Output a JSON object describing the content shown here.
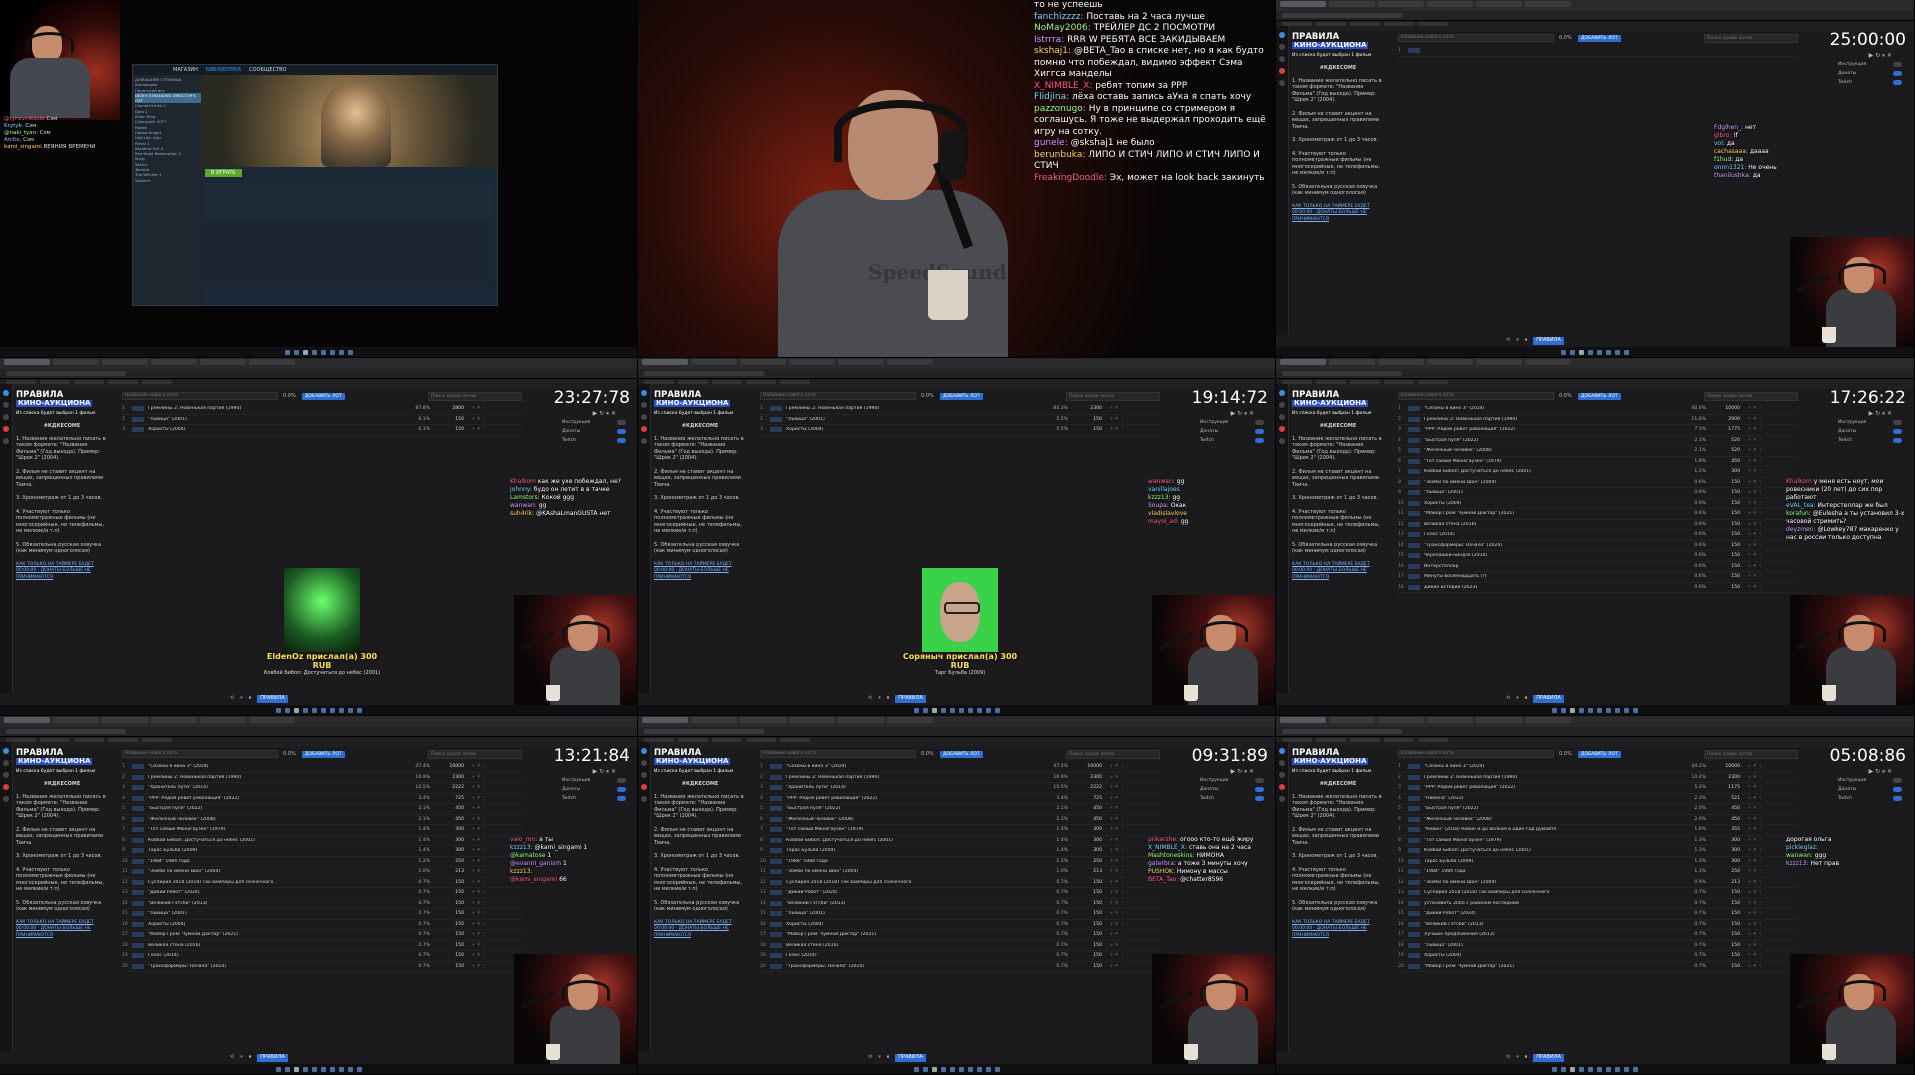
{
  "cell1": {
    "chat": [
      {
        "user": "@ryhevnikkolé",
        "msg": "Сэм"
      },
      {
        "user": "Krytyk:",
        "msg": "Сэм"
      },
      {
        "user": "@naki_tyan:",
        "msg": "Сэм"
      },
      {
        "user": "Arctis:",
        "msg": "Сэм"
      },
      {
        "user": "kami_singami",
        "msg": "ВЕЯНИЯ ВРЕМЕНИ"
      }
    ],
    "steam": {
      "nav": [
        "МАГАЗИН",
        "БИБЛИОТЕКА",
        "СООБЩЕСТВО"
      ],
      "play_label": "В ИГРАТЬ",
      "library": [
        "ДОМАШНЯЯ СТРАНИЦА",
        "Коллекции",
        "Пиратский игр",
        "DEATH STRANDING DIRECTOR'S CUT",
        "Counter-Strike 2",
        "Dota 2",
        "Elden Ring",
        "Cyberpunk 2077",
        "Hades",
        "Hollow Knight",
        "Half-Life: Alyx",
        "Portal 2",
        "Resident Evil 4",
        "Red Dead Redemption 2",
        "Stray",
        "Sekiro",
        "Terraria",
        "The Witcher 3",
        "Valheim"
      ]
    }
  },
  "cell2": {
    "shirt": "SpeedSound",
    "chat": [
      {
        "user": "",
        "msg": "то не успеешь"
      },
      {
        "user": "fanchizzzz:",
        "msg": "Поставь на 2 часа лучше"
      },
      {
        "user": "NoMay2006:",
        "msg": "ТРЕЙЛЕР ДС 2 ПОСМОТРИ"
      },
      {
        "user": "Istrrra:",
        "msg": "RRR W РЕБЯТА ВСЕ ЗАКИДЫВАЕМ"
      },
      {
        "user": "skshaj1:",
        "msg": "@BETA_Tao в списке нет, но я как будто помню что побеждал, видимо эффект Сэма Хиггса манделы"
      },
      {
        "user": "X_NIMBLE_X:",
        "msg": "ребят топим за РРР"
      },
      {
        "user": "Flidjina:",
        "msg": "лёха оставь запись аУка я спать хочу"
      },
      {
        "user": "pazzonugo:",
        "msg": "Ну в принципе со стримером я соглашусь. Я тоже не выдержал проходить ещё игру на сотку."
      },
      {
        "user": "gunele:",
        "msg": "@skshaj1 не было"
      },
      {
        "user": "berunbuka:",
        "msg": "ЛИПО И СТИЧ ЛИПО И СТИЧ ЛИПО И СТИЧ"
      },
      {
        "user": "FreakingDoodle:",
        "msg": "Эх, может на look back закинуть"
      }
    ]
  },
  "rules": {
    "heading": "ПРАВИЛА",
    "title": "КИНО-АУКЦИОНА",
    "note": "Из списка будет выбран 1 фильм",
    "hashtag": "#КДКЕСОМЕ",
    "items": [
      "1. Название желательно писать в таком формате: \"Название Фильма\" (Год выхода). Пример: \"Шрек 2\" (2004).",
      "2. Фильм не ставит акцент на вещах, запрещенных правилами Твича.",
      "3. Хронометраж от 1 до 3 часов.",
      "4. Участвуют только полнометражные фильмы (не многосерийные, не телефильмы, не мелкие/и т.п)",
      "5. Обязательна русская озвучка (как минимум одноголосая)"
    ],
    "link": "КАК ТОЛЬКО НА ТАЙМЕРЕ БУДЕТ 00:00:00 - ДОНАТЫ БОЛЬШЕ НЕ ПРИНИМАЮТСЯ"
  },
  "auction": {
    "lot_placeholder": "Название нового лота",
    "pct": "0.0%",
    "add_button": "ДОБАВИТЬ ЛОТ",
    "search_placeholder": "Поиск среди лотов",
    "side": [
      {
        "label": "Инструкция",
        "on": false
      },
      {
        "label": "Донаты",
        "on": true
      },
      {
        "label": "Twitch",
        "on": true
      }
    ],
    "bottom_button": "ПРАВИЛА"
  },
  "cells": [
    {
      "id": "cell4",
      "timer": "23:27:78",
      "lots": [
        {
          "n": "1",
          "title": "Гремлины 2: Новенькая партия (1990)",
          "pct": "87.8%",
          "sum": "2800"
        },
        {
          "n": "2",
          "title": "\"Львица\" (2001)",
          "pct": "6.1%",
          "sum": "150"
        },
        {
          "n": "3",
          "title": "Хористы (2004)",
          "pct": "6.1%",
          "sum": "150"
        }
      ],
      "chat": [
        {
          "user": "Khalkom",
          "msg": "как же ухе побеждал, не?"
        },
        {
          "user": "johnny:",
          "msg": "будо он летит в в тачке"
        },
        {
          "user": "Lamstors:",
          "msg": "Кокой ggg"
        },
        {
          "user": "wanwan:",
          "msg": "gg"
        },
        {
          "user": "suh4rik:",
          "msg": "@KAshaLmanGUSTA нет"
        }
      ],
      "donation": {
        "name": "EldenOz прислал(а) 300 RUB",
        "msg": "Ковбой Бибоп: Достучаться до небес (2001)"
      }
    },
    {
      "id": "cell5",
      "timer": "19:14:72",
      "lots": [
        {
          "n": "1",
          "title": "Гремлины 2: Новенькая партия (1990)",
          "pct": "84.3%",
          "sum": "2300"
        },
        {
          "n": "2",
          "title": "\"Львица\" (2001)",
          "pct": "5.5%",
          "sum": "150"
        },
        {
          "n": "3",
          "title": "Хористы (2004)",
          "pct": "5.5%",
          "sum": "150"
        }
      ],
      "chat": [
        {
          "user": "wanwan:",
          "msg": "gg"
        },
        {
          "user": "vanillajoes",
          "msg": ""
        },
        {
          "user": "kzzz13:",
          "msg": "gg"
        },
        {
          "user": "Soupa:",
          "msg": "Окак"
        },
        {
          "user": "vladislavlove",
          "msg": ""
        },
        {
          "user": "mayoi_ad:",
          "msg": "gg"
        }
      ],
      "donation": {
        "name": "Соряныч прислал(а) 300 RUB",
        "msg": "Тарг Бульба (2009)"
      }
    },
    {
      "id": "cell6",
      "timer": "17:26:22",
      "lots": [
        {
          "n": "1",
          "title": "\"Сезоны в кино 3\" (2024)",
          "pct": "40.0%",
          "sum": "10000"
        },
        {
          "n": "2",
          "title": "Гремлины 2: Новенькая партия (1990)",
          "pct": "11.6%",
          "sum": "2900"
        },
        {
          "n": "3",
          "title": "\"РРР: Рядом ревёт революция\" (2022)",
          "pct": "7.1%",
          "sum": "1775"
        },
        {
          "n": "4",
          "title": "\"Быстрая пуля\" (2022)",
          "pct": "2.1%",
          "sum": "520"
        },
        {
          "n": "5",
          "title": "\"Железный человек\" (2008)",
          "pct": "2.1%",
          "sum": "520"
        },
        {
          "n": "6",
          "title": "\"Тот самый Мюнхгаузен\" (1979)",
          "pct": "1.8%",
          "sum": "450"
        },
        {
          "n": "7",
          "title": "Ковбой Бибоп: Достучаться до небес (2001)",
          "pct": "1.2%",
          "sum": "300"
        },
        {
          "n": "8",
          "title": "\"Зомби по имени Шон\" (2004)",
          "pct": "0.6%",
          "sum": "150"
        },
        {
          "n": "9",
          "title": "\"Львица\" (2001)",
          "pct": "0.6%",
          "sum": "150"
        },
        {
          "n": "10",
          "title": "Хористы (2004)",
          "pct": "0.6%",
          "sum": "150"
        },
        {
          "n": "11",
          "title": "\"Майор Гром: Чумной Доктор\" (2021)",
          "pct": "0.6%",
          "sum": "150"
        },
        {
          "n": "12",
          "title": "Великая стена (2016)",
          "pct": "0.6%",
          "sum": "150"
        },
        {
          "n": "13",
          "title": "Голос (2014)",
          "pct": "0.6%",
          "sum": "150"
        },
        {
          "n": "14",
          "title": "\"Трансформеры: Начало\" (2024)",
          "pct": "0.6%",
          "sum": "150"
        },
        {
          "n": "15",
          "title": "Черепашки-ниндзя (2014)",
          "pct": "0.6%",
          "sum": "150"
        },
        {
          "n": "16",
          "title": "Интерстеллар",
          "pct": "0.6%",
          "sum": "150"
        },
        {
          "n": "17",
          "title": "Минуты восемнадцать (?)",
          "pct": "0.6%",
          "sum": "150"
        },
        {
          "n": "18",
          "title": "Дикие истории (2023)",
          "pct": "0.6%",
          "sum": "150"
        }
      ],
      "chat": [
        {
          "user": "Khalkom",
          "msg": "у меня есть ноут, мои ровесники (20 лет) до сих пор работают"
        },
        {
          "user": "eVAL_tea:",
          "msg": "Интерстеллар же был"
        },
        {
          "user": "korafun:",
          "msg": "@Eulesha а ты установил 3-х часовой стримить?"
        },
        {
          "user": "deyzmen:",
          "msg": "@Lowkey787 макаренко у нас в россии только доступна"
        }
      ]
    },
    {
      "id": "cell7",
      "timer": "13:21:84",
      "lots": [
        {
          "n": "1",
          "title": "\"Сезоны в кино 3\" (2024)",
          "pct": "47.4%",
          "sum": "10000"
        },
        {
          "n": "2",
          "title": "Гремлины 2: Новенькая партия (1990)",
          "pct": "10.9%",
          "sum": "2300"
        },
        {
          "n": "3",
          "title": "\"Хранитель пути\" (2014)",
          "pct": "10.5%",
          "sum": "2222"
        },
        {
          "n": "4",
          "title": "\"РРР: Рядом ревёт революция\" (2022)",
          "pct": "3.4%",
          "sum": "725"
        },
        {
          "n": "5",
          "title": "\"Быстрая пуля\" (2022)",
          "pct": "2.1%",
          "sum": "450"
        },
        {
          "n": "6",
          "title": "\"Железный человек\" (2008)",
          "pct": "2.1%",
          "sum": "450"
        },
        {
          "n": "7",
          "title": "\"Тот самый Мюнхгаузен\" (1979)",
          "pct": "1.4%",
          "sum": "300"
        },
        {
          "n": "8",
          "title": "Ковбой Бибоп: Достучаться до небес (2001)",
          "pct": "1.4%",
          "sum": "300"
        },
        {
          "n": "9",
          "title": "Тарас Бульба (2009)",
          "pct": "1.4%",
          "sum": "300"
        },
        {
          "n": "10",
          "title": "\"1984\" 1984 года",
          "pct": "1.2%",
          "sum": "250"
        },
        {
          "n": "11",
          "title": "\"Зомби по имени Шон\" (2004)",
          "pct": "1.0%",
          "sum": "213"
        },
        {
          "n": "12",
          "title": "Суспирия 2018 (2018) Так вампиры для солнечного",
          "pct": "0.7%",
          "sum": "150"
        },
        {
          "n": "13",
          "title": "\"Дикий Робот\" (2024)",
          "pct": "0.7%",
          "sum": "150"
        },
        {
          "n": "14",
          "title": "\"Великий Гэтсби\" (2013)",
          "pct": "0.7%",
          "sum": "150"
        },
        {
          "n": "15",
          "title": "\"Львица\" (2001)",
          "pct": "0.7%",
          "sum": "150"
        },
        {
          "n": "16",
          "title": "Хористы (2004)",
          "pct": "0.7%",
          "sum": "150"
        },
        {
          "n": "17",
          "title": "\"Майор Гром: Чумной Доктор\" (2021)",
          "pct": "0.7%",
          "sum": "150"
        },
        {
          "n": "18",
          "title": "Великая стена (2016)",
          "pct": "0.7%",
          "sum": "150"
        },
        {
          "n": "19",
          "title": "Голос (2014)",
          "pct": "0.7%",
          "sum": "150"
        },
        {
          "n": "20",
          "title": "\"Трансформеры: Начало\" (2024)",
          "pct": "0.7%",
          "sum": "150"
        }
      ],
      "chat": [
        {
          "user": "vaio_mn:",
          "msg": "а ты"
        },
        {
          "user": "kzzz13:",
          "msg": "@kami_singami 1"
        },
        {
          "user": "@kamatose",
          "msg": "1"
        },
        {
          "user": "@evanni_ganism",
          "msg": "1"
        },
        {
          "user": "kzzz13:",
          "msg": ""
        },
        {
          "user": "@kami_singami",
          "msg": "66"
        }
      ]
    },
    {
      "id": "cell8",
      "timer": "09:31:89",
      "lots": [
        {
          "n": "1",
          "title": "\"Сезоны в кино 3\" (2024)",
          "pct": "47.4%",
          "sum": "10000"
        },
        {
          "n": "2",
          "title": "Гремлины 2: Новенькая партия (1990)",
          "pct": "10.9%",
          "sum": "2300"
        },
        {
          "n": "3",
          "title": "\"Хранитель пути\" (2014)",
          "pct": "10.5%",
          "sum": "2222"
        },
        {
          "n": "4",
          "title": "\"РРР: Рядом ревёт революция\" (2022)",
          "pct": "3.4%",
          "sum": "725"
        },
        {
          "n": "5",
          "title": "\"Быстрая пуля\" (2022)",
          "pct": "2.1%",
          "sum": "450"
        },
        {
          "n": "6",
          "title": "\"Железный человек\" (2008)",
          "pct": "2.1%",
          "sum": "450"
        },
        {
          "n": "7",
          "title": "\"Тот самый Мюнхгаузен\" (1979)",
          "pct": "1.4%",
          "sum": "300"
        },
        {
          "n": "8",
          "title": "Ковбой Бибоп: Достучаться до небес (2001)",
          "pct": "1.4%",
          "sum": "300"
        },
        {
          "n": "9",
          "title": "Тарас Бульба (2009)",
          "pct": "1.4%",
          "sum": "300"
        },
        {
          "n": "10",
          "title": "\"1984\" 1984 года",
          "pct": "1.2%",
          "sum": "250"
        },
        {
          "n": "11",
          "title": "\"Зомби по имени Шон\" (2004)",
          "pct": "1.0%",
          "sum": "213"
        },
        {
          "n": "12",
          "title": "Суспирия 2018 (2018) Так вампиры для солнечного",
          "pct": "0.7%",
          "sum": "150"
        },
        {
          "n": "13",
          "title": "\"Дикий Робот\" (2024)",
          "pct": "0.7%",
          "sum": "150"
        },
        {
          "n": "14",
          "title": "\"Великий Гэтсби\" (2013)",
          "pct": "0.7%",
          "sum": "150"
        },
        {
          "n": "15",
          "title": "\"Львица\" (2001)",
          "pct": "0.7%",
          "sum": "150"
        },
        {
          "n": "16",
          "title": "Хористы (2004)",
          "pct": "0.7%",
          "sum": "150"
        },
        {
          "n": "17",
          "title": "\"Майор Гром: Чумной Доктор\" (2021)",
          "pct": "0.7%",
          "sum": "150"
        },
        {
          "n": "18",
          "title": "Великая стена (2016)",
          "pct": "0.7%",
          "sum": "150"
        },
        {
          "n": "19",
          "title": "Голос (2014)",
          "pct": "0.7%",
          "sum": "150"
        },
        {
          "n": "20",
          "title": "\"Трансформеры: Начало\" (2024)",
          "pct": "0.7%",
          "sum": "150"
        }
      ],
      "chat": [
        {
          "user": "prikarshe:",
          "msg": "огооо кто-то ещё жиру"
        },
        {
          "user": "X_NIMBLE_X:",
          "msg": "ставь она на 2 часа"
        },
        {
          "user": "Mashtoneskins:",
          "msg": "НИМОНА"
        },
        {
          "user": "gaterbra:",
          "msg": "а тоже 3 минуты хочу"
        },
        {
          "user": "PUSHOK:",
          "msg": "Нимону в массы"
        },
        {
          "user": "BETA_Tao:",
          "msg": "@chatter8596"
        }
      ]
    },
    {
      "id": "cell9",
      "timer": "05:08:86",
      "lots": [
        {
          "n": "1",
          "title": "\"Сезоны в кино 3\" (2024)",
          "pct": "44.2%",
          "sum": "10000"
        },
        {
          "n": "2",
          "title": "Гремлины 2: Новенькая партия (1990)",
          "pct": "10.2%",
          "sum": "2300"
        },
        {
          "n": "3",
          "title": "\"РРР: Рядом ревёт революция\" (2022)",
          "pct": "5.2%",
          "sum": "1175"
        },
        {
          "n": "4",
          "title": "\"Нимона\" (2023)",
          "pct": "2.3%",
          "sum": "521"
        },
        {
          "n": "5",
          "title": "\"Быстрая пуля\" (2022)",
          "pct": "2.0%",
          "sum": "450"
        },
        {
          "n": "6",
          "title": "\"Железный человек\" (2008)",
          "pct": "2.0%",
          "sum": "450"
        },
        {
          "n": "7",
          "title": "\"Кевин\" (2018) Кевин и до волком в один год думайте",
          "pct": "1.6%",
          "sum": "355"
        },
        {
          "n": "8",
          "title": "\"Тот самый Мюнхгаузен\" (1979)",
          "pct": "1.3%",
          "sum": "300"
        },
        {
          "n": "9",
          "title": "Ковбой Бибоп: Достучаться до небес (2001)",
          "pct": "1.3%",
          "sum": "300"
        },
        {
          "n": "10",
          "title": "Тарас Бульба (2009)",
          "pct": "1.3%",
          "sum": "300"
        },
        {
          "n": "11",
          "title": "\"1984\" 1984 года",
          "pct": "1.1%",
          "sum": "250"
        },
        {
          "n": "12",
          "title": "\"Зомби по имени Шон\" (2004)",
          "pct": "0.9%",
          "sum": "213"
        },
        {
          "n": "13",
          "title": "Суспирия 2018 (2018) Так вампиры для солнечного",
          "pct": "0.7%",
          "sum": "150"
        },
        {
          "n": "14",
          "title": "установить 2005 с районом последний",
          "pct": "0.7%",
          "sum": "150"
        },
        {
          "n": "15",
          "title": "\"Дикий Робот\" (2024)",
          "pct": "0.7%",
          "sum": "150"
        },
        {
          "n": "16",
          "title": "\"Великий Гэтсби\" (2013)",
          "pct": "0.7%",
          "sum": "150"
        },
        {
          "n": "17",
          "title": "Лучшие предложения (2013)",
          "pct": "0.7%",
          "sum": "150"
        },
        {
          "n": "18",
          "title": "\"Львица\" (2001)",
          "pct": "0.7%",
          "sum": "150"
        },
        {
          "n": "19",
          "title": "Хористы (2004)",
          "pct": "0.7%",
          "sum": "150"
        },
        {
          "n": "20",
          "title": "\"Майор Гром: Чумной Доктор\" (2021)",
          "pct": "0.7%",
          "sum": "150"
        }
      ],
      "chat": [
        {
          "user": "",
          "msg": "дорогая ольга"
        },
        {
          "user": "pickleglaz:",
          "msg": ""
        },
        {
          "user": "wanwan:",
          "msg": "ggg"
        },
        {
          "user": "kzzz13:",
          "msg": "Нет прав"
        }
      ]
    }
  ]
}
